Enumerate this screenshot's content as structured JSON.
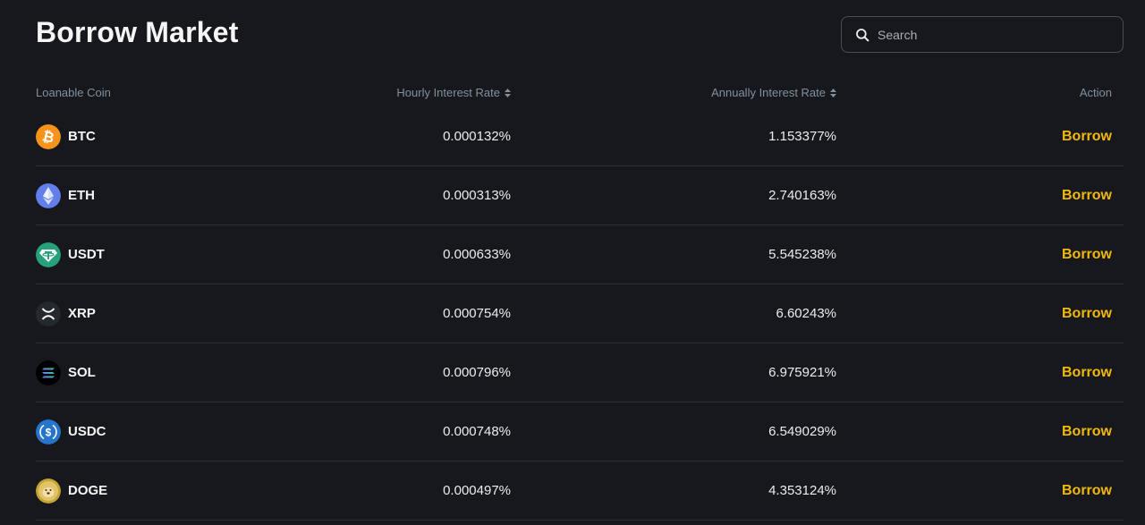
{
  "page": {
    "title": "Borrow Market"
  },
  "search": {
    "placeholder": "Search"
  },
  "table": {
    "headers": {
      "coin": "Loanable Coin",
      "hourly": "Hourly Interest Rate",
      "annual": "Annually Interest Rate",
      "action": "Action"
    },
    "rows": [
      {
        "coin": "BTC",
        "icon": "btc-icon",
        "hourly": "0.000132%",
        "annual": "1.153377%",
        "action": "Borrow"
      },
      {
        "coin": "ETH",
        "icon": "eth-icon",
        "hourly": "0.000313%",
        "annual": "2.740163%",
        "action": "Borrow"
      },
      {
        "coin": "USDT",
        "icon": "usdt-icon",
        "hourly": "0.000633%",
        "annual": "5.545238%",
        "action": "Borrow"
      },
      {
        "coin": "XRP",
        "icon": "xrp-icon",
        "hourly": "0.000754%",
        "annual": "6.60243%",
        "action": "Borrow"
      },
      {
        "coin": "SOL",
        "icon": "sol-icon",
        "hourly": "0.000796%",
        "annual": "6.975921%",
        "action": "Borrow"
      },
      {
        "coin": "USDC",
        "icon": "usdc-icon",
        "hourly": "0.000748%",
        "annual": "6.549029%",
        "action": "Borrow"
      },
      {
        "coin": "DOGE",
        "icon": "doge-icon",
        "hourly": "0.000497%",
        "annual": "4.353124%",
        "action": "Borrow"
      }
    ]
  },
  "colors": {
    "background": "#17181e",
    "accent": "#f0b90b",
    "divider": "#2b2f36",
    "muted_text": "#848e9c"
  }
}
